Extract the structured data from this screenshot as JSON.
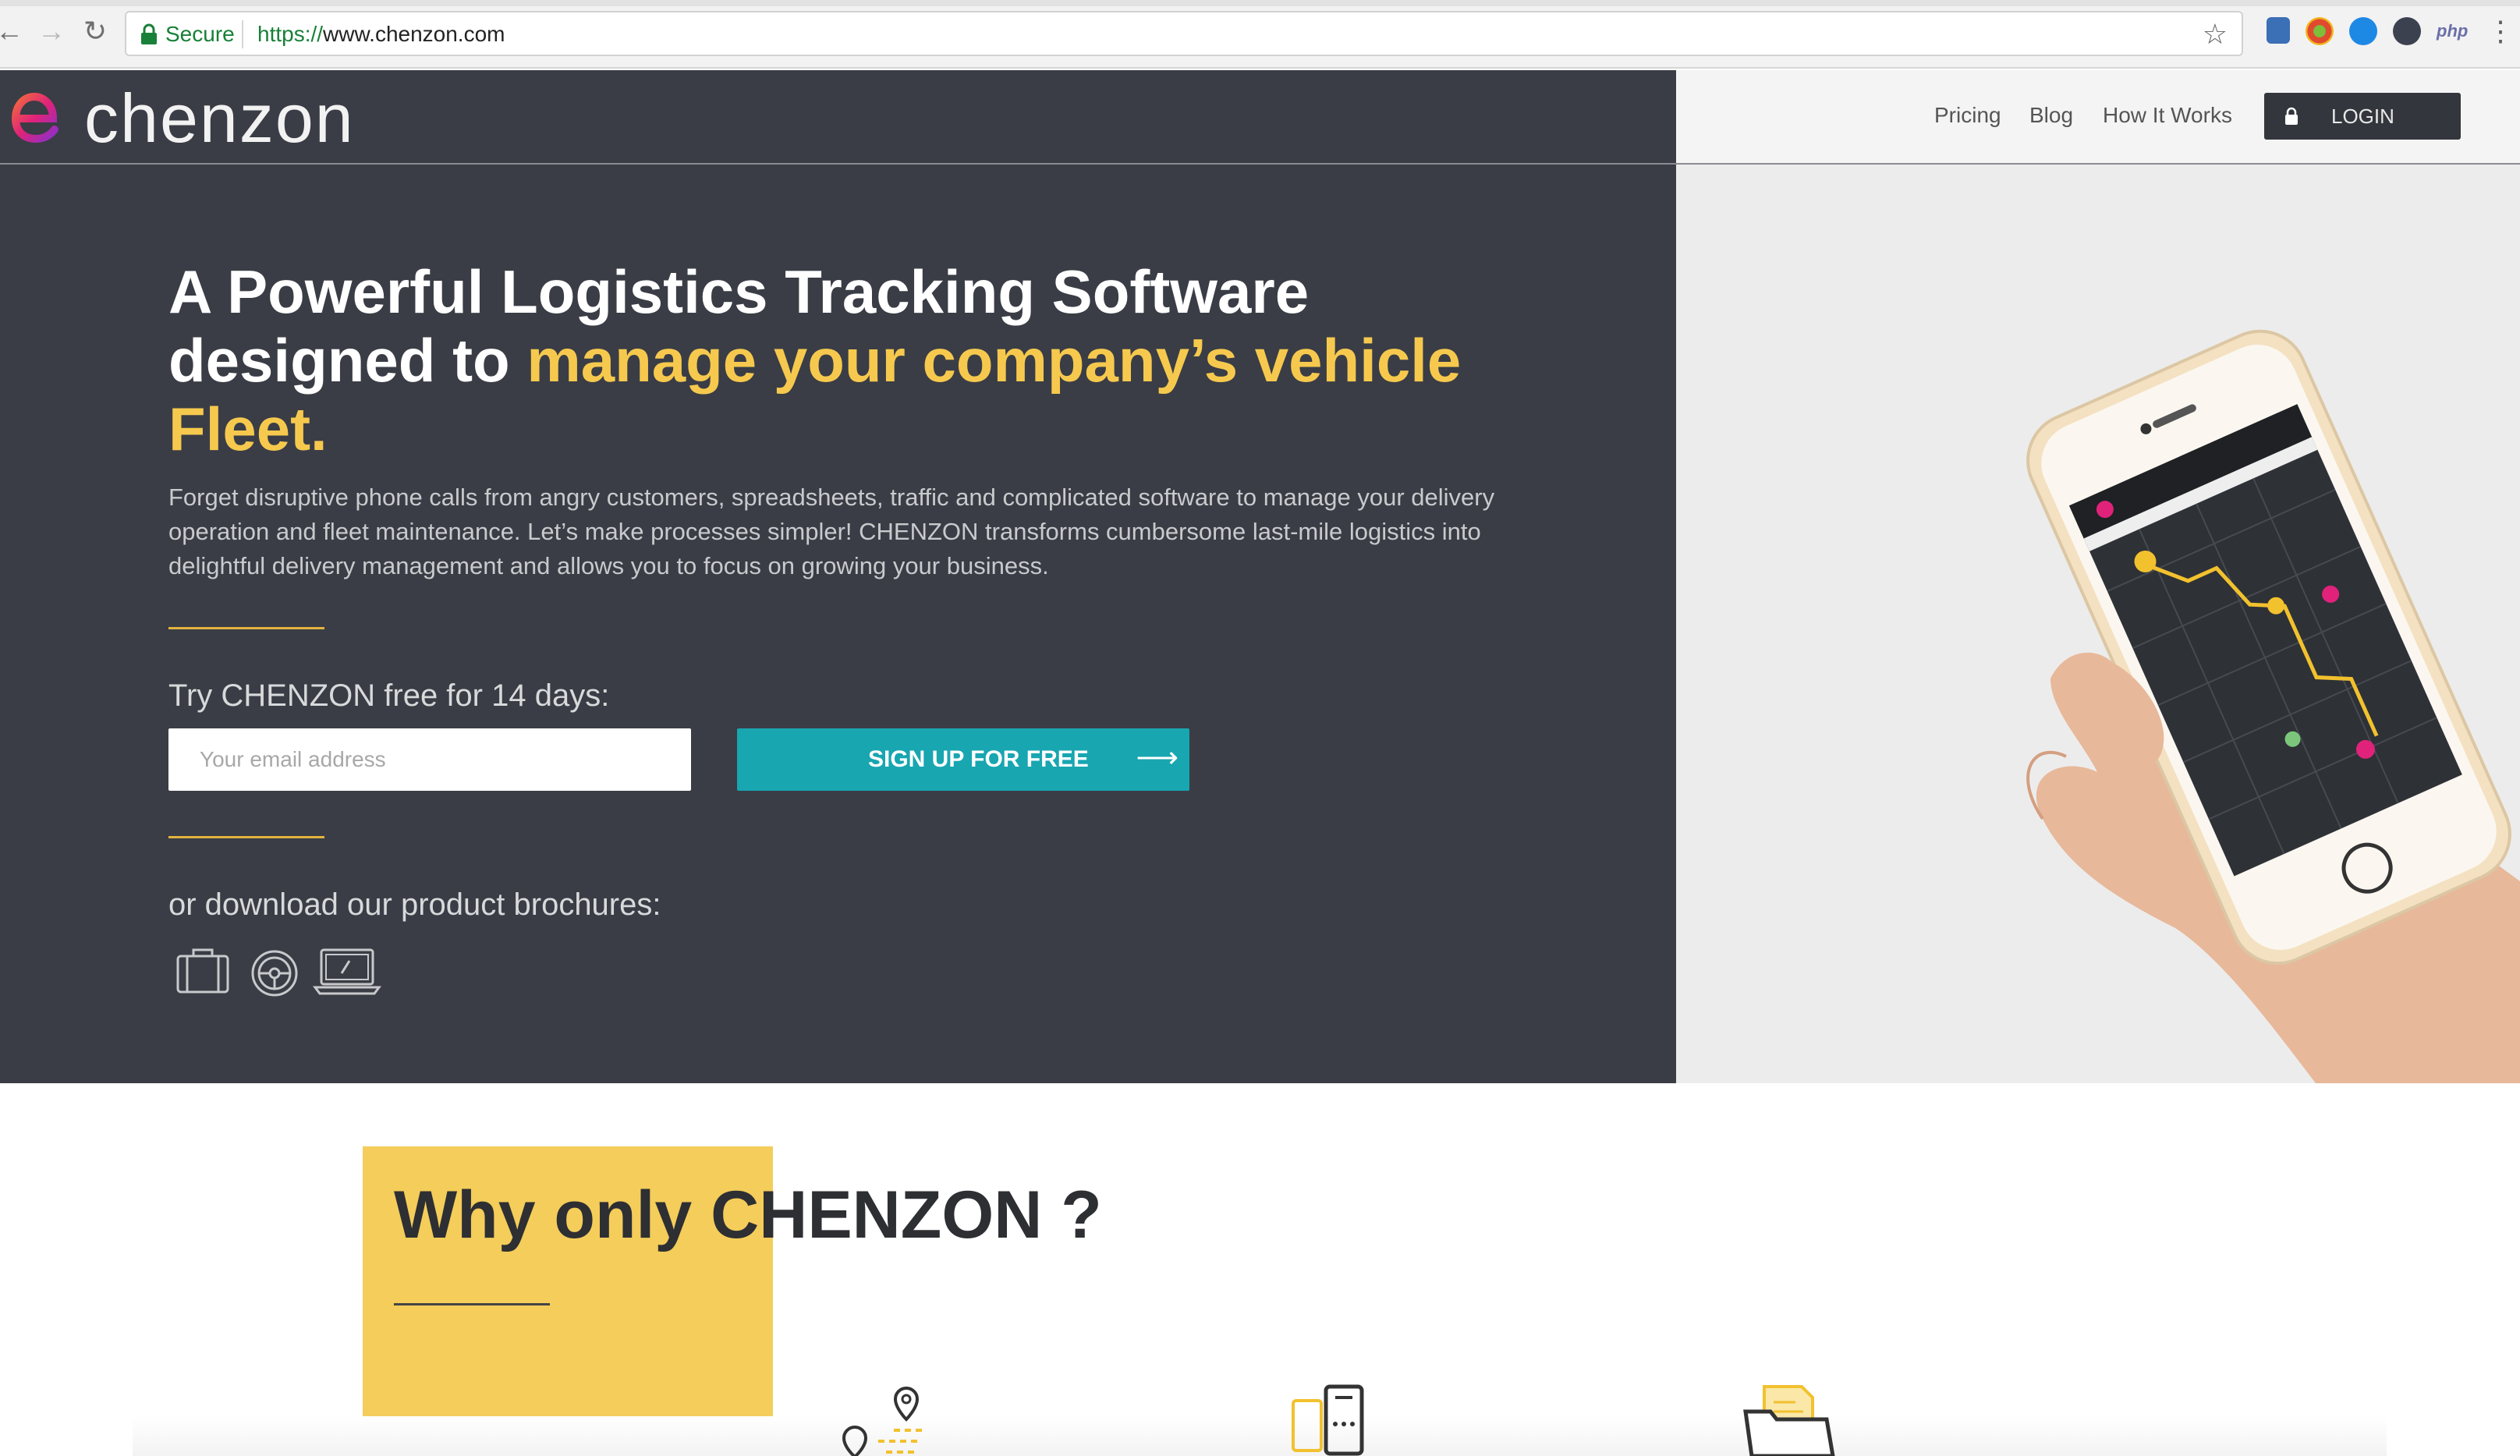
{
  "browser": {
    "secure_label": "Secure",
    "url_prefix": "https://",
    "url_host": "www.chenzon.com",
    "ext_php_label": "php"
  },
  "header": {
    "logo_text": "chenzon",
    "nav": [
      {
        "label": "Pricing"
      },
      {
        "label": "Blog"
      },
      {
        "label": "How It Works"
      }
    ],
    "login_label": "LOGIN"
  },
  "hero": {
    "title_part1": "A Powerful Logistics Tracking Software designed to ",
    "title_highlight": "manage your company’s vehicle Fleet.",
    "subtitle": "Forget disruptive phone calls from angry customers, spreadsheets, traffic and complicated software to manage your delivery operation and fleet maintenance. Let’s make processes simpler! CHENZON transforms cumbersome last-mile logistics into delightful delivery management and allows you to focus on growing your business.",
    "try_text": "Try CHENZON free for 14 days:",
    "email_placeholder": "Your email address",
    "signup_label": "SIGN UP FOR FREE",
    "download_text": "or download our product brochures:",
    "brochure_icons": [
      "briefcase-icon",
      "steering-wheel-icon",
      "laptop-icon"
    ]
  },
  "why": {
    "title": "Why only CHENZON ?",
    "feature_icons": [
      "map-pin-route-icon",
      "mobile-chat-icon",
      "folder-document-icon"
    ]
  },
  "colors": {
    "hero_bg": "#3a3d45",
    "accent_yellow": "#f6c94e",
    "cta_teal": "#18a6b1",
    "why_yellow": "#f4cd5a"
  }
}
